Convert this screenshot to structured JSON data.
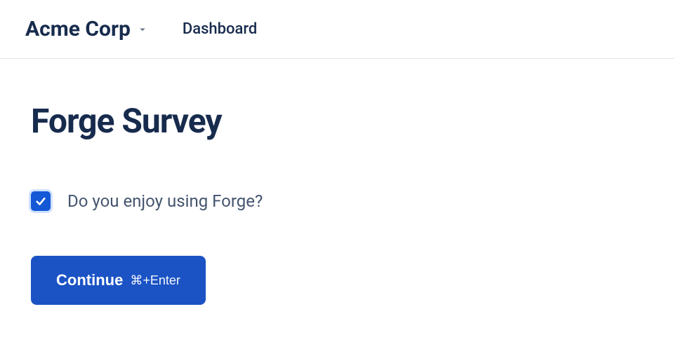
{
  "header": {
    "org_name": "Acme Corp",
    "nav_link": "Dashboard"
  },
  "main": {
    "title": "Forge Survey",
    "question": {
      "checked": true,
      "label": "Do you enjoy using Forge?"
    },
    "button": {
      "label": "Continue",
      "hint": "⌘+Enter"
    }
  }
}
